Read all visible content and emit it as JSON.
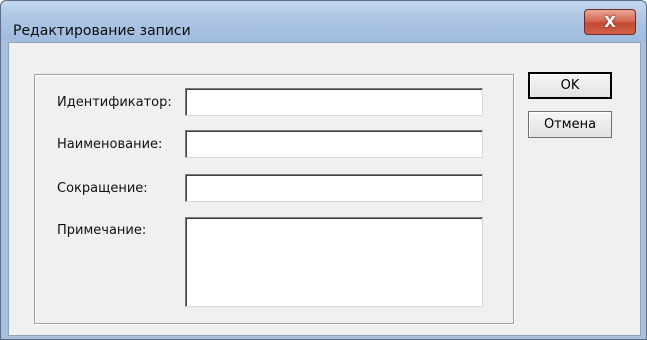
{
  "window": {
    "title": "Редактирование записи",
    "close_glyph": "X"
  },
  "form": {
    "fields": [
      {
        "label": "Идентификатор:",
        "value": ""
      },
      {
        "label": "Наименование:",
        "value": ""
      },
      {
        "label": "Сокращение:",
        "value": ""
      },
      {
        "label": "Примечание:",
        "value": ""
      }
    ]
  },
  "buttons": {
    "ok_label": "OK",
    "cancel_label": "Отмена"
  },
  "colors": {
    "title_bar": "#aec6e4",
    "close_button": "#c24a33",
    "client_background": "#f0f0f0"
  }
}
